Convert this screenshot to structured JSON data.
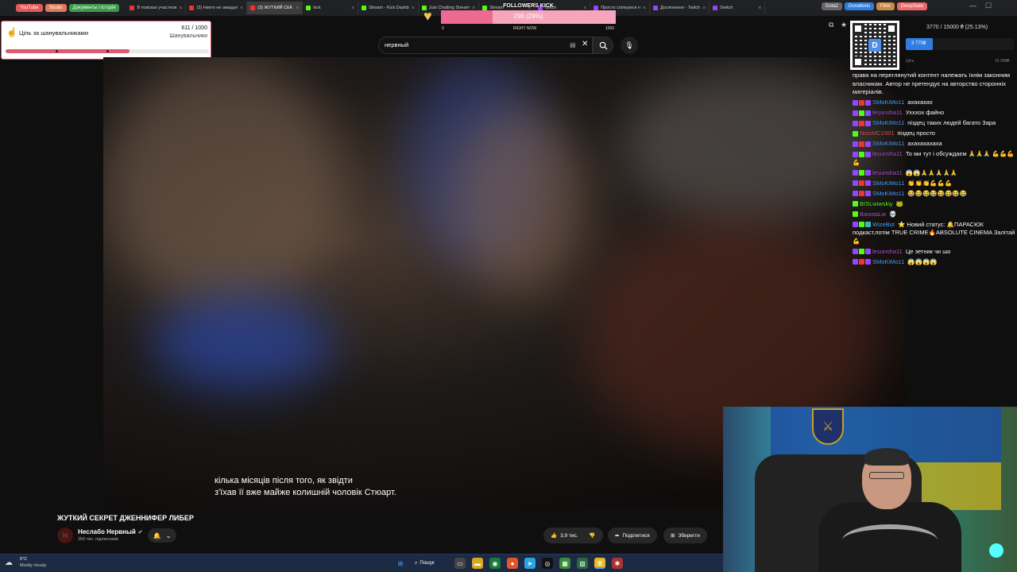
{
  "bookmarks": [
    {
      "label": "YouTube",
      "color": "#e05a5a"
    },
    {
      "label": "Studio",
      "color": "#e07a5a"
    },
    {
      "label": "Документы і історія",
      "color": "#3a9a4a"
    }
  ],
  "tabs": [
    {
      "label": "В поисках участнов",
      "color": "#e33"
    },
    {
      "label": "(3) Никто не ожидал",
      "color": "#e33"
    },
    {
      "label": "(3) ЖУТКИЙ СЕК",
      "color": "#e33",
      "active": true
    },
    {
      "label": "kick",
      "color": "#53fc18"
    },
    {
      "label": "Stream - Kick Dashb",
      "color": "#53fc18"
    },
    {
      "label": "Just Chatting Stream",
      "color": "#53fc18"
    },
    {
      "label": "Stream",
      "color": "#53fc18"
    },
    {
      "label": "twitch",
      "color": "#9147ff"
    },
    {
      "label": "Просто спілкуюся н",
      "color": "#9147ff"
    },
    {
      "label": "Досягнення - Twitch",
      "color": "#9147ff"
    },
    {
      "label": "Switch",
      "color": "#9147ff"
    }
  ],
  "right_bookmarks": [
    {
      "label": "Dota2",
      "color": "#666"
    },
    {
      "label": "Donations",
      "color": "#2f7de1"
    },
    {
      "label": "Filmi",
      "color": "#c84"
    },
    {
      "label": "DeepState",
      "color": "#e66"
    }
  ],
  "followers_widget": {
    "title": "FOLLOWERS KICK",
    "value_text": "296 (29%)",
    "fraction": 0.296,
    "min": "0",
    "mid": "RIGHT NOW",
    "max": "1000"
  },
  "honor_goal": {
    "title": "Ціль за шанувальниками",
    "count": "611 / 1000",
    "subtitle": "Шанувальники",
    "fraction": 0.611
  },
  "search": {
    "value": "нервный"
  },
  "video": {
    "subtitle_line1": "кілька місяців після того, як звідти",
    "subtitle_line2": "з'їхав її вже майже колишній чоловік Стюарт.",
    "title": "ЖУТКИЙ СЕКРЕТ ДЖЕННИФЕР ЛИБЕР",
    "channel": "Неслабо Нервный",
    "subscribers": "350 тис. підписників",
    "likes": "3,9 тис.",
    "share": "Поділитися",
    "save": "Зберегти"
  },
  "donation": {
    "progress_text": "3770 / 15000 ₴ (25.13%)",
    "fill_label": "3 770₴",
    "fraction": 0.2513,
    "min": "Ціль",
    "max": "15 000₴"
  },
  "chat": [
    {
      "user": "",
      "text": "права на переглянутий контент належать їхнім законним власникам. Автор не претендує на авторство сторонніх матеріалів.",
      "color": "#fff",
      "badges": []
    },
    {
      "user": "SMoKiMo11",
      "text": "ахахахах",
      "color": "#4aa3ff",
      "badges": [
        "#9147ff",
        "#e33",
        "#9147ff"
      ]
    },
    {
      "user": "lesunsha11",
      "text": "Ухххох файно",
      "color": "#b05ac8",
      "badges": [
        "#9147ff",
        "#53fc18",
        "#9147ff"
      ]
    },
    {
      "user": "SMoKiMo11",
      "text": "піздец таких людей багато Зара",
      "color": "#4aa3ff",
      "badges": [
        "#9147ff",
        "#e33",
        "#9147ff"
      ]
    },
    {
      "user": "NoizMC1991",
      "text": "піздец просто",
      "color": "#e05a5a",
      "badges": [
        "#53fc18"
      ]
    },
    {
      "user": "SMoKiMo11",
      "text": "ахахахахаха",
      "color": "#4aa3ff",
      "badges": [
        "#9147ff",
        "#e33",
        "#9147ff"
      ]
    },
    {
      "user": "lesunsha11",
      "text": "То ми тут і обсуждаєм 🙏🙏🙏 💪💪💪💪",
      "color": "#b05ac8",
      "badges": [
        "#9147ff",
        "#53fc18",
        "#9147ff"
      ]
    },
    {
      "user": "lesunsha11",
      "text": "😱😱🙏🙏🙏🙏🙏",
      "color": "#b05ac8",
      "badges": [
        "#9147ff",
        "#53fc18",
        "#9147ff"
      ]
    },
    {
      "user": "SMoKiMo11",
      "text": "👏👏👏💪💪💪",
      "color": "#4aa3ff",
      "badges": [
        "#9147ff",
        "#e33",
        "#9147ff"
      ]
    },
    {
      "user": "SMoKiMo11",
      "text": "😂😂😂😂😂😂😂😂",
      "color": "#4aa3ff",
      "badges": [
        "#9147ff",
        "#e33",
        "#9147ff"
      ]
    },
    {
      "user": "BISLwiwskiy",
      "text": "🐸",
      "color": "#53fc18",
      "badges": [
        "#53fc18"
      ]
    },
    {
      "user": "BasotaLw",
      "text": "💀",
      "color": "#b05ac8",
      "badges": [
        "#53fc18"
      ]
    },
    {
      "user": "WizeBot",
      "text": "⭐ Новий статус: 🔔ПАРАСЮК подкаст,потім TRUE CRIME🔥ABSOLUTE CINEMA Залітай 💪",
      "color": "#4aa3ff",
      "badges": [
        "#9147ff",
        "#53fc18",
        "#3bb"
      ]
    },
    {
      "user": "lesunsha11",
      "text": "Це зетник чи шо",
      "color": "#b05ac8",
      "badges": [
        "#9147ff",
        "#53fc18",
        "#9147ff"
      ]
    },
    {
      "user": "SMoKiMo11",
      "text": "😱😱😱😱",
      "color": "#4aa3ff",
      "badges": [
        "#9147ff",
        "#e33",
        "#9147ff"
      ]
    }
  ],
  "taskbar": {
    "temperature": "5°C",
    "weather": "Mostly cloudy",
    "search_label": "Пошук"
  },
  "colors": {
    "accent_pink": "#ee6a93",
    "donation_blue": "#2f7de1",
    "goal_red": "#e05a6e"
  }
}
